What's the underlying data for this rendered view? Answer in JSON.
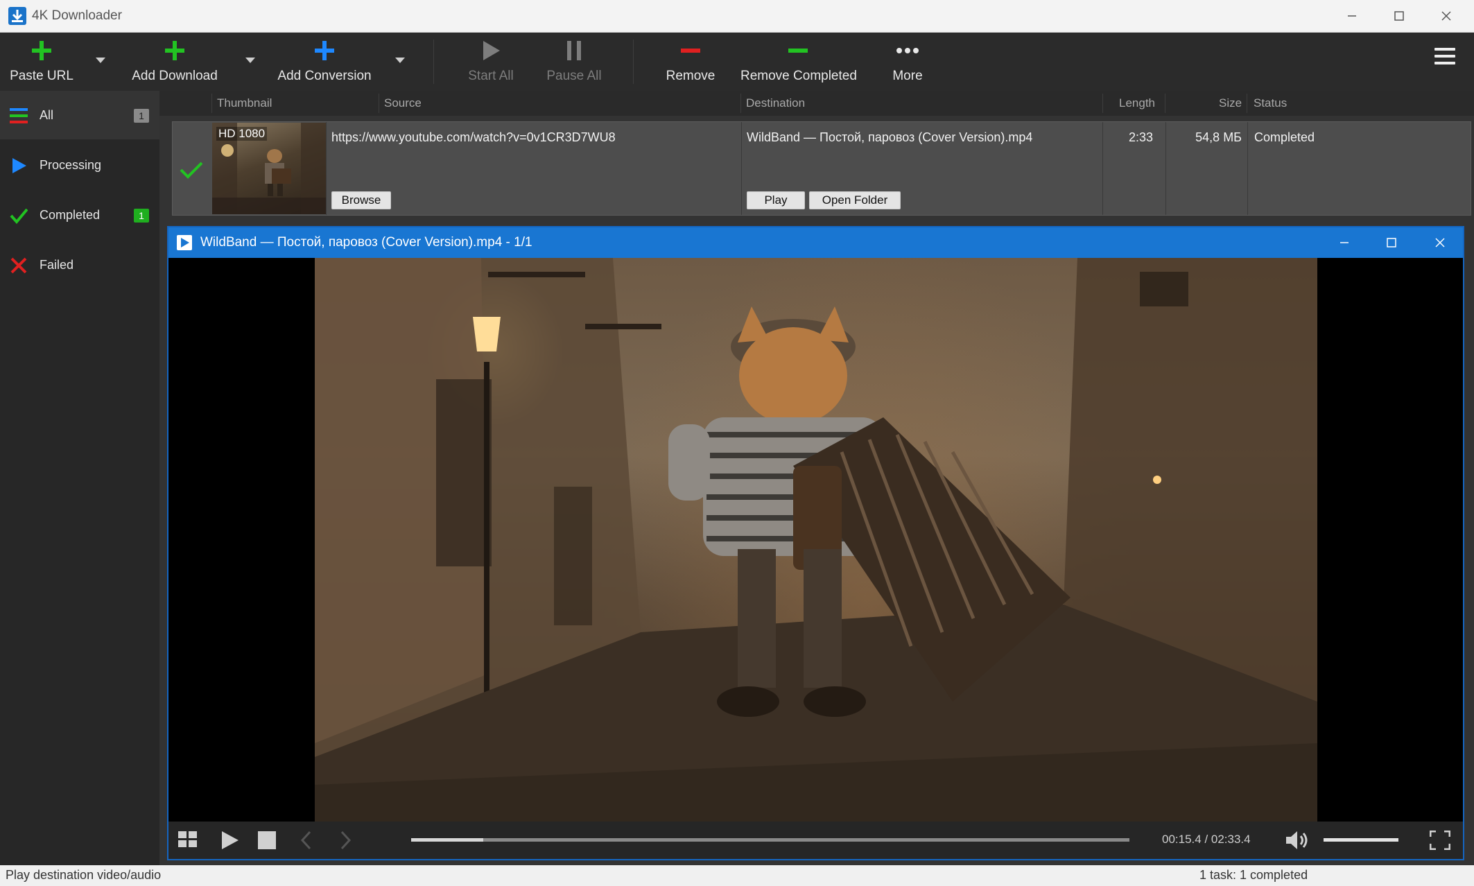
{
  "window": {
    "title": "4K Downloader"
  },
  "toolbar": {
    "paste_url": "Paste URL",
    "add_download": "Add Download",
    "add_conversion": "Add Conversion",
    "start_all": "Start All",
    "pause_all": "Pause All",
    "remove": "Remove",
    "remove_completed": "Remove Completed",
    "more": "More"
  },
  "sidebar": {
    "items": [
      {
        "label": "All",
        "badge": "1",
        "icon": "list-icon"
      },
      {
        "label": "Processing",
        "icon": "play-icon"
      },
      {
        "label": "Completed",
        "badge": "1",
        "icon": "check-icon"
      },
      {
        "label": "Failed",
        "icon": "x-icon"
      }
    ]
  },
  "columns": {
    "thumbnail": "Thumbnail",
    "source": "Source",
    "destination": "Destination",
    "length": "Length",
    "size": "Size",
    "status": "Status"
  },
  "row": {
    "quality": "HD 1080",
    "source_url": "https://www.youtube.com/watch?v=0v1CR3D7WU8",
    "browse": "Browse",
    "destination": "WildBand — Постой, паровоз (Cover Version).mp4",
    "play": "Play",
    "open_folder": "Open Folder",
    "length": "2:33",
    "size": "54,8 МБ",
    "status": "Completed"
  },
  "player": {
    "title": "WildBand — Постой, паровоз (Cover Version).mp4 - 1/1",
    "time": "00:15.4 / 02:33.4",
    "progress_fraction": 0.1,
    "volume_fraction": 1.0
  },
  "statusbar": {
    "left": "Play destination video/audio",
    "right": "1 task: 1 completed"
  },
  "colors": {
    "accent_blue": "#1976d2",
    "add_green": "#22c322",
    "remove_red": "#e02020",
    "badge_green": "#1fae1f"
  }
}
